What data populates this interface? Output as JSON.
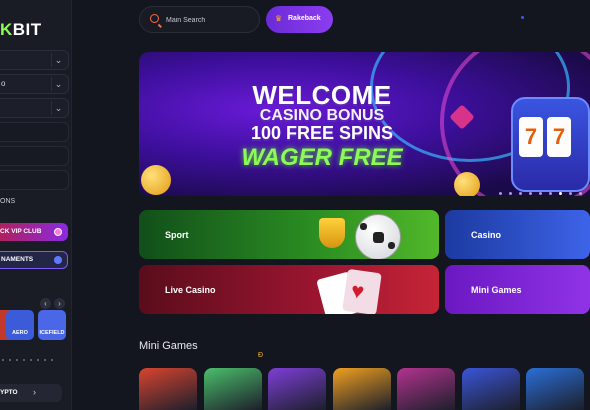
{
  "sidebar": {
    "logo_left": "K",
    "logo_right": "BIT",
    "rows": [
      {
        "label": "",
        "chevron": "⌄"
      },
      {
        "label": "o",
        "chevron": "⌄"
      },
      {
        "label": "",
        "chevron": "⌄"
      }
    ],
    "plain_rows": [
      "",
      "",
      ""
    ],
    "promotions_label": "ONS",
    "vip_label": "CK VIP CLUB",
    "tournaments_label": "NAMENTS",
    "carousel_prev": "‹",
    "carousel_next": "›",
    "mini_tiles": [
      {
        "text": "",
        "color": "#c0392b"
      },
      {
        "text": "AERO",
        "color": "#3b5bd9"
      },
      {
        "text": "ICEFIELD",
        "color": "#4a67e8"
      }
    ],
    "crypto_label": "YPTO",
    "crypto_arrow": "›"
  },
  "header": {
    "search_placeholder": "Main Search",
    "rakeback_label": "Rakeback"
  },
  "hero": {
    "line1": "WELCOME",
    "line2": "CASINO BONUS",
    "line3": "100 FREE SPINS",
    "line4": "WAGER FREE",
    "reel_symbol": "7",
    "active_slide": 6,
    "slide_count": 9
  },
  "categories": [
    {
      "label": "Sport",
      "color": "#2c8f22"
    },
    {
      "label": "Casino",
      "color": "#3d63e8"
    },
    {
      "label": "Live Casino",
      "color": "#9c1530"
    },
    {
      "label": "Mini Games",
      "color": "#8f33e6"
    }
  ],
  "mini_games": {
    "title": "Mini Games",
    "marker": "Ð",
    "tiles": [
      {
        "name": "game-1",
        "color": "#d9442f"
      },
      {
        "name": "game-2",
        "color": "#4bbf6b"
      },
      {
        "name": "game-3",
        "color": "#7e3fd8"
      },
      {
        "name": "game-4",
        "color": "#f0a020"
      },
      {
        "name": "game-5",
        "color": "#b3338f"
      },
      {
        "name": "game-6",
        "color": "#3b55d8"
      },
      {
        "name": "game-7",
        "color": "#2a6fd8"
      }
    ]
  },
  "colors": {
    "brand_green": "#8dfa57",
    "accent_purple": "#7a35e6",
    "search_icon": "#ff6a3d"
  }
}
